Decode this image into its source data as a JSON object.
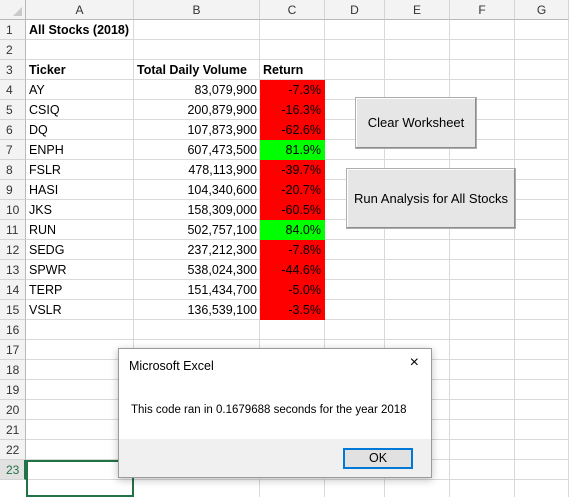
{
  "columns": [
    "A",
    "B",
    "C",
    "D",
    "E",
    "F",
    "G"
  ],
  "rows": [
    "1",
    "2",
    "3",
    "4",
    "5",
    "6",
    "7",
    "8",
    "9",
    "10",
    "11",
    "12",
    "13",
    "14",
    "15",
    "16",
    "17",
    "18",
    "19",
    "20",
    "21",
    "22",
    "23"
  ],
  "title_cell": "All Stocks (2018)",
  "headers": {
    "ticker": "Ticker",
    "volume": "Total Daily Volume",
    "return": "Return"
  },
  "stocks": [
    {
      "ticker": "AY",
      "volume": "83,079,900",
      "return": "-7.3%",
      "color": "#ff0000"
    },
    {
      "ticker": "CSIQ",
      "volume": "200,879,900",
      "return": "-16.3%",
      "color": "#ff0000"
    },
    {
      "ticker": "DQ",
      "volume": "107,873,900",
      "return": "-62.6%",
      "color": "#ff0000"
    },
    {
      "ticker": "ENPH",
      "volume": "607,473,500",
      "return": "81.9%",
      "color": "#00ff00"
    },
    {
      "ticker": "FSLR",
      "volume": "478,113,900",
      "return": "-39.7%",
      "color": "#ff0000"
    },
    {
      "ticker": "HASI",
      "volume": "104,340,600",
      "return": "-20.7%",
      "color": "#ff0000"
    },
    {
      "ticker": "JKS",
      "volume": "158,309,000",
      "return": "-60.5%",
      "color": "#ff0000"
    },
    {
      "ticker": "RUN",
      "volume": "502,757,100",
      "return": "84.0%",
      "color": "#00ff00"
    },
    {
      "ticker": "SEDG",
      "volume": "237,212,300",
      "return": "-7.8%",
      "color": "#ff0000"
    },
    {
      "ticker": "SPWR",
      "volume": "538,024,300",
      "return": "-44.6%",
      "color": "#ff0000"
    },
    {
      "ticker": "TERP",
      "volume": "151,434,700",
      "return": "-5.0%",
      "color": "#ff0000"
    },
    {
      "ticker": "VSLR",
      "volume": "136,539,100",
      "return": "-3.5%",
      "color": "#ff0000"
    }
  ],
  "buttons": {
    "clear": "Clear Worksheet",
    "run": "Run Analysis for All Stocks"
  },
  "dialog": {
    "title": "Microsoft Excel",
    "close": "×",
    "message": "This code ran in 0.1679688 seconds for the year 2018",
    "ok": "OK"
  },
  "colors": {
    "negative": "#ff0000",
    "positive": "#00ff00",
    "excel_green": "#217346"
  }
}
